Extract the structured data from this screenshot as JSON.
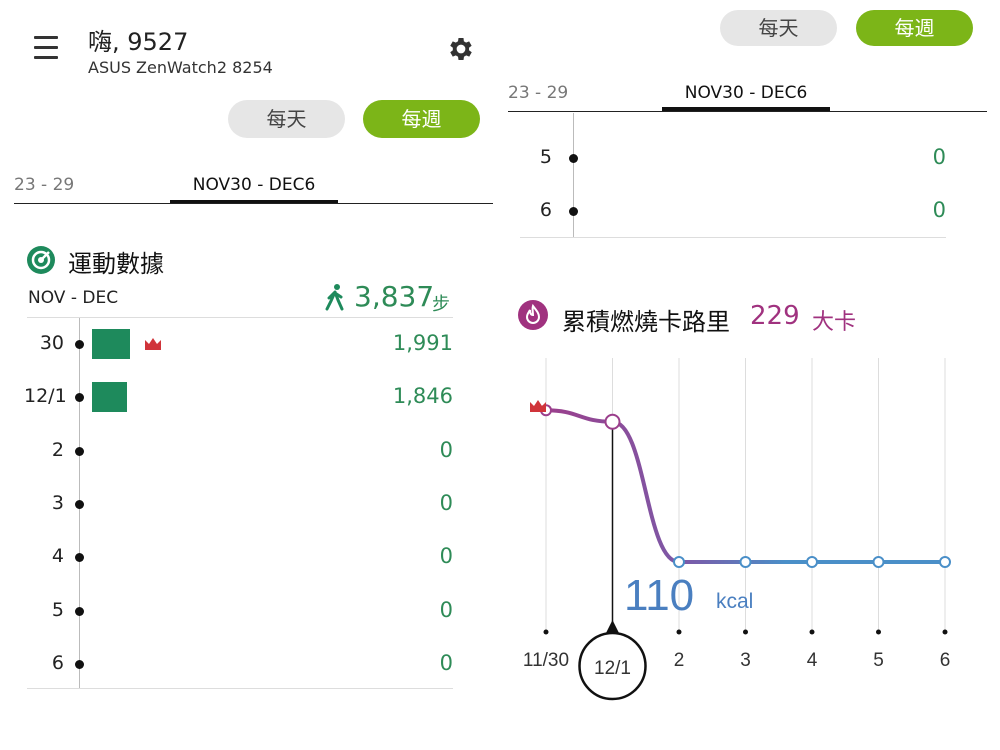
{
  "header": {
    "greeting": "嗨, 9527",
    "device": "ASUS ZenWatch2 8254",
    "menu_icon": "hamburger-menu-icon",
    "settings_icon": "gear-icon"
  },
  "toggle": {
    "daily": "每天",
    "weekly": "每週",
    "selected": "weekly"
  },
  "tabs": {
    "prev": "23 - 29",
    "current": "NOV30 - DEC6"
  },
  "activity": {
    "title": "運動數據",
    "icon": "target-icon",
    "period": "NOV - DEC",
    "total": "3,837",
    "total_unit": "步",
    "rows": [
      {
        "day": "30",
        "value": "1,991",
        "steps": 1991
      },
      {
        "day": "12/1",
        "value": "1,846",
        "steps": 1846
      },
      {
        "day": "2",
        "value": "0",
        "steps": 0
      },
      {
        "day": "3",
        "value": "0",
        "steps": 0
      },
      {
        "day": "4",
        "value": "0",
        "steps": 0
      },
      {
        "day": "5",
        "value": "0",
        "steps": 0
      },
      {
        "day": "6",
        "value": "0",
        "steps": 0
      }
    ]
  },
  "right_panel": {
    "toggle": {
      "daily": "每天",
      "weekly": "每週"
    },
    "tabs": {
      "prev": "23 - 29",
      "current": "NOV30 - DEC6"
    },
    "rows": [
      {
        "day": "5",
        "value": "0"
      },
      {
        "day": "6",
        "value": "0"
      }
    ]
  },
  "calories": {
    "title": "累積燃燒卡路里",
    "total": "229",
    "unit": "大卡",
    "icon": "flame-icon",
    "selected_value": "110",
    "selected_unit": "kcal",
    "selected_label": "12/1"
  },
  "chart_data": {
    "type": "line",
    "categories": [
      "11/30",
      "12/1",
      "2",
      "3",
      "4",
      "5",
      "6"
    ],
    "series": [
      {
        "values": [
          119,
          110,
          0,
          0,
          0,
          0,
          0
        ]
      }
    ],
    "highlight_index": 1,
    "best_index": 0,
    "colors": {
      "line_start": "#9b3f8c",
      "line_end": "#4a8fc8",
      "callout": "#4a7fc0"
    }
  },
  "colors": {
    "accent": "#7cb518",
    "steps": "#1e8a5c",
    "calories": "#a0327f",
    "crown": "#d0343a"
  }
}
